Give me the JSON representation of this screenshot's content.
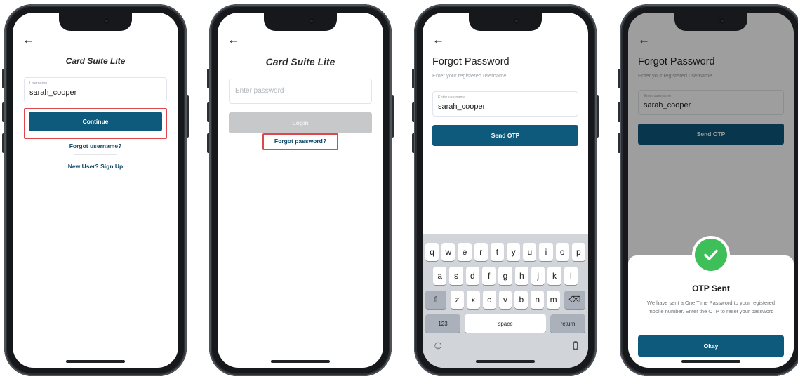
{
  "colors": {
    "primary": "#0e5a7d",
    "highlight": "#e0474c",
    "success": "#3fbf5a"
  },
  "screen1": {
    "back_icon": "←",
    "brand": "Card Suite Lite",
    "username_label": "Username",
    "username_value": "sarah_cooper",
    "continue_label": "Continue",
    "forgot_username": "Forgot username?",
    "signup": "New User? Sign Up"
  },
  "screen2": {
    "back_icon": "←",
    "brand": "Card Suite Lite",
    "password_placeholder": "Enter password",
    "login_label": "Login",
    "forgot_password": "Forgot password?"
  },
  "screen3": {
    "back_icon": "←",
    "title": "Forgot Password",
    "subtitle": "Enter your registered username",
    "field_label": "Enter username",
    "field_value": "sarah_cooper",
    "send_label": "Send OTP",
    "keyboard": {
      "row1": [
        "q",
        "w",
        "e",
        "r",
        "t",
        "y",
        "u",
        "i",
        "o",
        "p"
      ],
      "row2": [
        "a",
        "s",
        "d",
        "f",
        "g",
        "h",
        "j",
        "k",
        "l"
      ],
      "row3": [
        "z",
        "x",
        "c",
        "v",
        "b",
        "n",
        "m"
      ],
      "shift_icon": "⇧",
      "delete_icon": "⌫",
      "numbers": "123",
      "space": "space",
      "return": "return",
      "emoji_icon": "☺",
      "mic_icon": "🎤"
    }
  },
  "screen4": {
    "back_icon": "←",
    "title": "Forgot Password",
    "subtitle": "Enter your registered username",
    "field_label": "Enter username",
    "field_value": "sarah_cooper",
    "send_label": "Send OTP",
    "sheet_title": "OTP Sent",
    "sheet_body": "We have sent a One Time Password to your registered mobile number. Enter the OTP to reset your password",
    "okay_label": "Okay",
    "check_icon": "✓"
  }
}
